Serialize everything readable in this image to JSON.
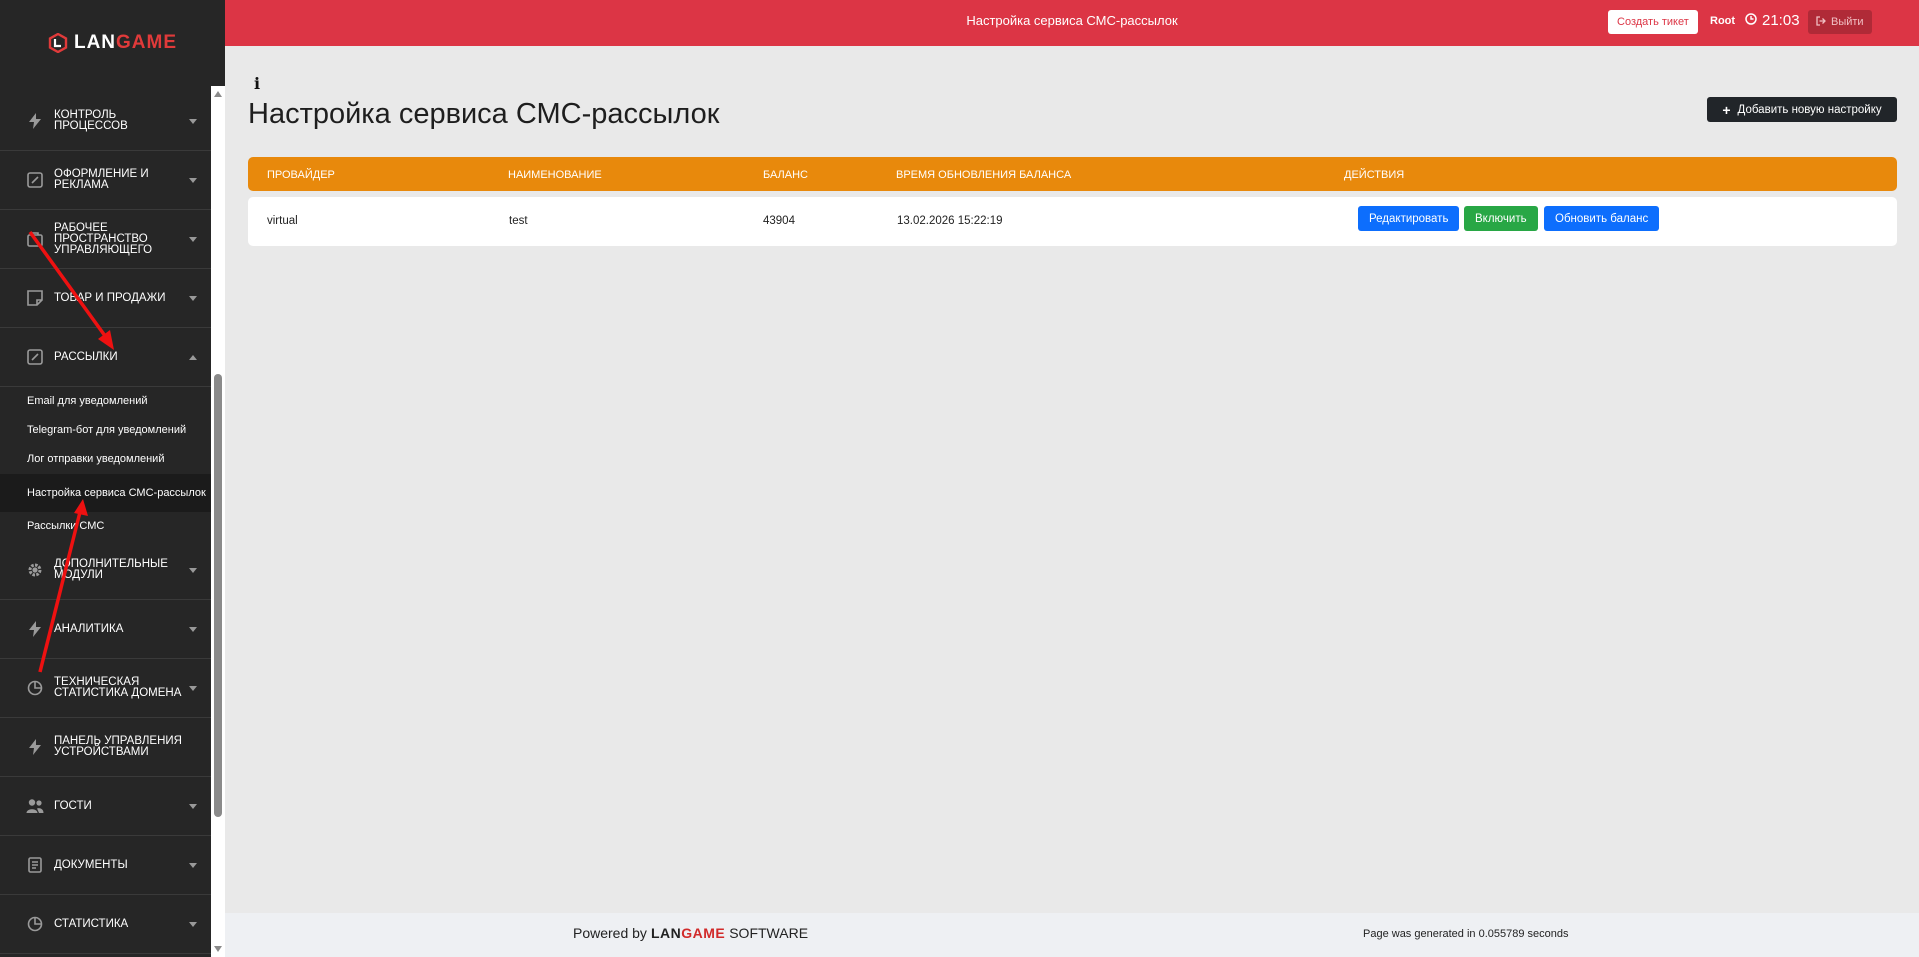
{
  "logo": {
    "text_main": "LAN",
    "text_accent": "GAME"
  },
  "sidebar": {
    "items": [
      {
        "label": "Контроль процессов",
        "icon": "bolt-icon",
        "caret": "down"
      },
      {
        "label": "Оформление и реклама",
        "icon": "edit-square-icon",
        "caret": "down"
      },
      {
        "label": "Рабочее пространство управляющего",
        "icon": "briefcase-icon",
        "caret": "down"
      },
      {
        "label": "Товар и продажи",
        "icon": "sticky-note-icon",
        "caret": "down"
      },
      {
        "label": "Рассылки",
        "icon": "edit-square-icon",
        "caret": "up"
      }
    ],
    "subitems": [
      {
        "label": "Email для уведомлений"
      },
      {
        "label": "Telegram-бот для уведомлений"
      },
      {
        "label": "Лог отправки уведомлений"
      },
      {
        "label": "Настройка сервиса СМС-рассылок",
        "active": true
      },
      {
        "label": "Рассылки СМС"
      }
    ],
    "items_after": [
      {
        "label": "Дополнительные модули",
        "icon": "gear-icon",
        "caret": "down"
      },
      {
        "label": "Аналитика",
        "icon": "bolt-icon",
        "caret": "down"
      },
      {
        "label": "Техническая статистика домена",
        "icon": "pie-chart-icon",
        "caret": "down"
      },
      {
        "label": "Панель управления устройствами",
        "icon": "bolt-icon",
        "caret": "none"
      },
      {
        "label": "Гости",
        "icon": "users-icon",
        "caret": "down"
      },
      {
        "label": "Документы",
        "icon": "document-icon",
        "caret": "down"
      },
      {
        "label": "Статистика",
        "icon": "pie-chart-icon",
        "caret": "down"
      }
    ]
  },
  "topbar": {
    "title": "Настройка сервиса СМС-рассылок",
    "ticket_button": "Создать тикет",
    "user": "Root",
    "time": "21:03",
    "logout": "Выйти"
  },
  "main": {
    "title": "Настройка сервиса СМС-рассылок",
    "add_button": "Добавить новую настройку",
    "table": {
      "headers": [
        "Провайдер",
        "Наименование",
        "Баланс",
        "Время обновления баланса",
        "Действия"
      ],
      "rows": [
        {
          "provider": "virtual",
          "name": "test",
          "balance": "43904",
          "updated": "13.02.2026 15:22:19",
          "actions": {
            "edit": "Редактировать",
            "enable": "Включить",
            "refresh": "Обновить баланс"
          }
        }
      ]
    }
  },
  "footer": {
    "powered_by": "Powered by",
    "brand_main": "LAN",
    "brand_accent": "GAME",
    "brand_suffix": "SOFTWARE",
    "generated": "Page was generated in 0.055789 seconds"
  },
  "colors": {
    "topbar": "#dc3545",
    "sidebar": "#262626",
    "table_header": "#e8890c",
    "primary": "#0d6efd",
    "success": "#28a745"
  }
}
